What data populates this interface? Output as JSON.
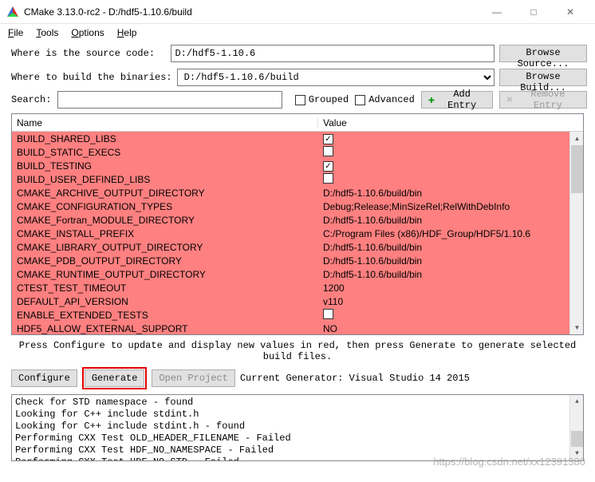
{
  "window": {
    "title": "CMake 3.13.0-rc2 - D:/hdf5-1.10.6/build",
    "min_icon": "—",
    "max_icon": "□",
    "close_icon": "✕"
  },
  "menu": {
    "file": "File",
    "tools": "Tools",
    "options": "Options",
    "help": "Help"
  },
  "labels": {
    "source": "Where is the source code:  ",
    "build": "Where to build the binaries:",
    "search": "Search:",
    "grouped": "Grouped",
    "advanced": "Advanced",
    "add_entry": "Add Entry",
    "remove_entry": "Remove Entry",
    "browse_source": "Browse Source...",
    "browse_build": "Browse Build...",
    "name": "Name",
    "value": "Value",
    "hint": "Press Configure to update and display new values in red, then press Generate to generate selected build files.",
    "configure": "Configure",
    "generate": "Generate",
    "open_project": "Open Project",
    "current_gen": "Current Generator: Visual Studio 14 2015"
  },
  "fields": {
    "source_path": "D:/hdf5-1.10.6",
    "build_path": "D:/hdf5-1.10.6/build",
    "search": ""
  },
  "check_glyph": "✓",
  "entries": [
    {
      "name": "BUILD_SHARED_LIBS",
      "type": "check",
      "checked": true
    },
    {
      "name": "BUILD_STATIC_EXECS",
      "type": "check",
      "checked": false
    },
    {
      "name": "BUILD_TESTING",
      "type": "check",
      "checked": true
    },
    {
      "name": "BUILD_USER_DEFINED_LIBS",
      "type": "check",
      "checked": false
    },
    {
      "name": "CMAKE_ARCHIVE_OUTPUT_DIRECTORY",
      "type": "text",
      "value": "D:/hdf5-1.10.6/build/bin"
    },
    {
      "name": "CMAKE_CONFIGURATION_TYPES",
      "type": "text",
      "value": "Debug;Release;MinSizeRel;RelWithDebInfo"
    },
    {
      "name": "CMAKE_Fortran_MODULE_DIRECTORY",
      "type": "text",
      "value": "D:/hdf5-1.10.6/build/bin"
    },
    {
      "name": "CMAKE_INSTALL_PREFIX",
      "type": "text",
      "value": "C:/Program Files (x86)/HDF_Group/HDF5/1.10.6"
    },
    {
      "name": "CMAKE_LIBRARY_OUTPUT_DIRECTORY",
      "type": "text",
      "value": "D:/hdf5-1.10.6/build/bin"
    },
    {
      "name": "CMAKE_PDB_OUTPUT_DIRECTORY",
      "type": "text",
      "value": "D:/hdf5-1.10.6/build/bin"
    },
    {
      "name": "CMAKE_RUNTIME_OUTPUT_DIRECTORY",
      "type": "text",
      "value": "D:/hdf5-1.10.6/build/bin"
    },
    {
      "name": "CTEST_TEST_TIMEOUT",
      "type": "text",
      "value": "1200"
    },
    {
      "name": "DEFAULT_API_VERSION",
      "type": "text",
      "value": "v110"
    },
    {
      "name": "ENABLE_EXTENDED_TESTS",
      "type": "check",
      "checked": false
    },
    {
      "name": "HDF5_ALLOW_EXTERNAL_SUPPORT",
      "type": "text",
      "value": "NO"
    }
  ],
  "log_lines": [
    "Check for STD namespace - found",
    "Looking for C++ include stdint.h",
    "Looking for C++ include stdint.h - found",
    "Performing CXX Test OLD_HEADER_FILENAME - Failed",
    "Performing CXX Test HDF_NO_NAMESPACE - Failed",
    "Performing CXX Test HDF_NO_STD - Failed"
  ],
  "watermark": "https://blog.csdn.net/xx12391380"
}
